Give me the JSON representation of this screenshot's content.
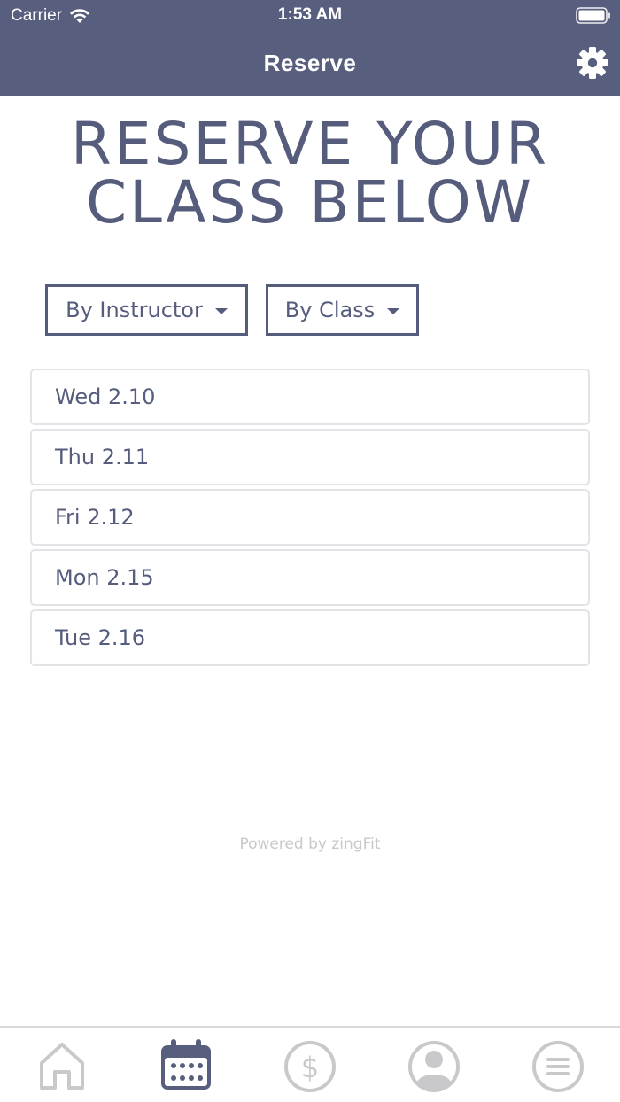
{
  "status_bar": {
    "carrier": "Carrier",
    "time": "1:53 AM"
  },
  "nav": {
    "title": "Reserve"
  },
  "headline": {
    "line1": "RESERVE YOUR",
    "line2": "CLASS BELOW"
  },
  "filters": [
    {
      "label": "By Instructor"
    },
    {
      "label": "By Class"
    }
  ],
  "dates": [
    {
      "label": "Wed 2.10"
    },
    {
      "label": "Thu 2.11"
    },
    {
      "label": "Fri 2.12"
    },
    {
      "label": "Mon 2.15"
    },
    {
      "label": "Tue 2.16"
    }
  ],
  "footer": {
    "powered_by": "Powered by zingFit"
  },
  "tabs": [
    {
      "icon": "home-icon",
      "active": false
    },
    {
      "icon": "calendar-icon",
      "active": true
    },
    {
      "icon": "dollar-icon",
      "active": false
    },
    {
      "icon": "profile-icon",
      "active": false
    },
    {
      "icon": "menu-icon",
      "active": false
    }
  ],
  "colors": {
    "brand": "#585e7e",
    "text": "#565c7c",
    "inactive_icon": "#c9c9cc",
    "border": "#e3e3e8"
  }
}
